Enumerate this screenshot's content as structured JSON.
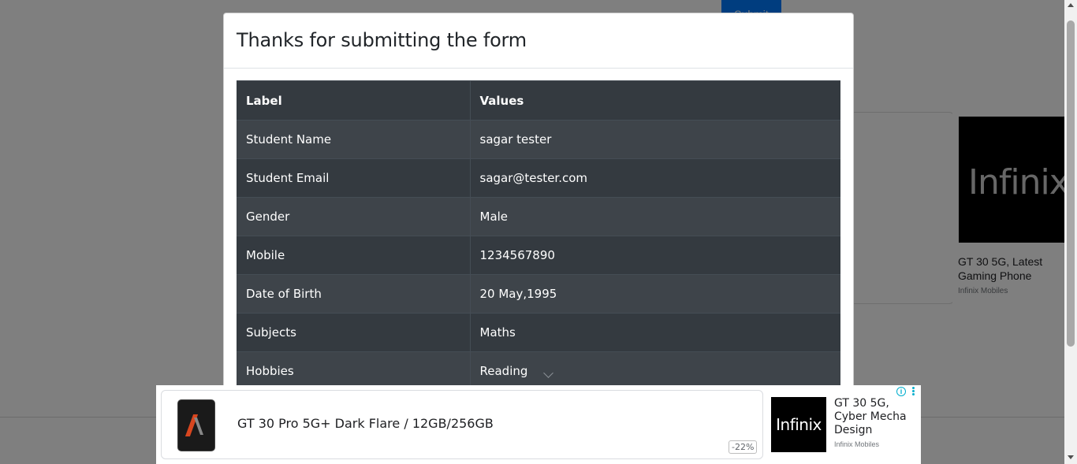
{
  "background": {
    "submit_label": "Submit",
    "ad_card": {
      "logo_text": "Infinix",
      "title": "GT 30 5G, Latest Gaming Phone",
      "source": "Infinix Mobiles"
    }
  },
  "modal": {
    "title": "Thanks for submitting the form",
    "table": {
      "headers": [
        "Label",
        "Values"
      ],
      "rows": [
        {
          "label": "Student Name",
          "value": "sagar tester"
        },
        {
          "label": "Student Email",
          "value": "sagar@tester.com"
        },
        {
          "label": "Gender",
          "value": "Male"
        },
        {
          "label": "Mobile",
          "value": "1234567890"
        },
        {
          "label": "Date of Birth",
          "value": "20 May,1995"
        },
        {
          "label": "Subjects",
          "value": "Maths"
        },
        {
          "label": "Hobbies",
          "value": "Reading"
        }
      ]
    }
  },
  "ad_banner": {
    "product_title": "GT 30 Pro 5G+ Dark Flare / 12GB/256GB",
    "discount": "-22%",
    "logo_text": "Infinix",
    "side_title": "GT 30 5G, Cyber Mecha Design",
    "side_source": "Infinix Mobiles",
    "info_icon": "info-icon",
    "more_icon": "more-vertical-icon"
  },
  "colors": {
    "overlay": "rgba(0,0,0,0.5)",
    "table_dark": "#343a40",
    "table_stripe": "#3e444a",
    "ad_accent": "#00aecd",
    "primary": "#007bff"
  }
}
